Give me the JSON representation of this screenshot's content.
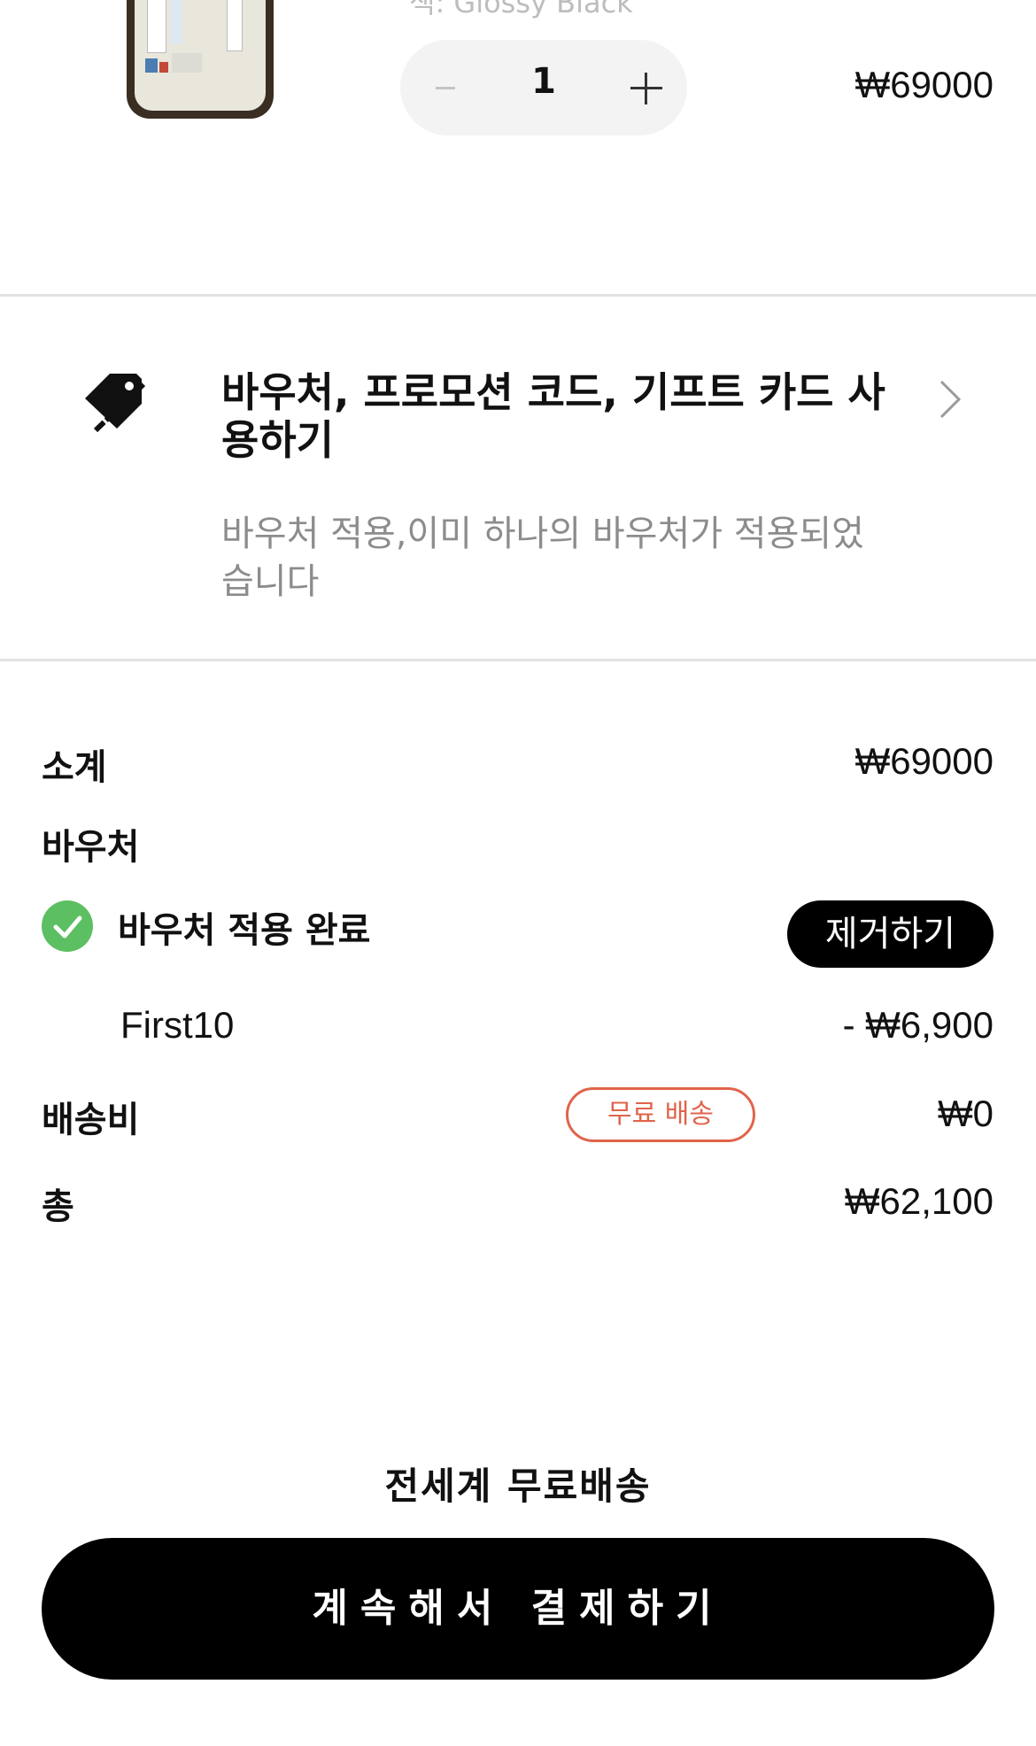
{
  "cart_item": {
    "variant": "색: Glossy Black",
    "quantity": "1",
    "price": "₩69000"
  },
  "voucher_entry": {
    "title": "바우처, 프로모션 코드, 기프트 카드 사용하기",
    "subtitle": "바우처 적용,이미 하나의 바우처가 적용되었습니다"
  },
  "summary": {
    "subtotal_label": "소계",
    "subtotal_value": "₩69000",
    "voucher_label": "바우처",
    "voucher_applied": "바우처 적용 완료",
    "remove_label": "제거하기",
    "voucher_code": "First10",
    "voucher_discount": "- ₩6,900",
    "shipping_label": "배송비",
    "shipping_badge": "무료 배송",
    "shipping_value": "₩0",
    "total_label": "총",
    "total_value": "₩62,100"
  },
  "footer": {
    "worldwide_note": "전세계 무료배송",
    "checkout_label": "계속해서 결제하기"
  },
  "colors": {
    "accent_green": "#5cbf62",
    "badge_red": "#e0644b"
  }
}
